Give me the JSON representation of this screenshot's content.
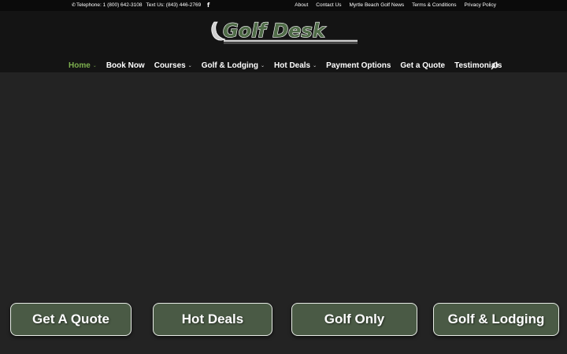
{
  "topbar": {
    "telephone": "Telephone: 1 (800) 642-3108",
    "text_us": "Text Us: (843) 446-2769",
    "facebook_glyph": "f",
    "links": [
      "About",
      "Contact Us",
      "Myrtle Beach Golf News",
      "Terms & Conditions",
      "Privacy Policy"
    ]
  },
  "logo": {
    "text": "Golf Desk"
  },
  "nav": {
    "items": [
      {
        "label": "Home",
        "dropdown": true,
        "active": true
      },
      {
        "label": "Book Now",
        "dropdown": false
      },
      {
        "label": "Courses",
        "dropdown": true
      },
      {
        "label": "Golf & Lodging",
        "dropdown": true
      },
      {
        "label": "Hot Deals",
        "dropdown": true
      },
      {
        "label": "Payment Options",
        "dropdown": false
      },
      {
        "label": "Get a Quote",
        "dropdown": false
      },
      {
        "label": "Testimonials",
        "dropdown": false
      }
    ],
    "chevron": "⌄"
  },
  "cta": {
    "get_quote": "Get A Quote",
    "hot_deals": "Hot Deals",
    "golf_only": "Golf Only",
    "golf_lodging": "Golf & Lodging"
  },
  "colors": {
    "accent": "#7db04e",
    "button_bg": "#4a5a45",
    "page_bg": "#232323",
    "header_bg": "#141414"
  }
}
